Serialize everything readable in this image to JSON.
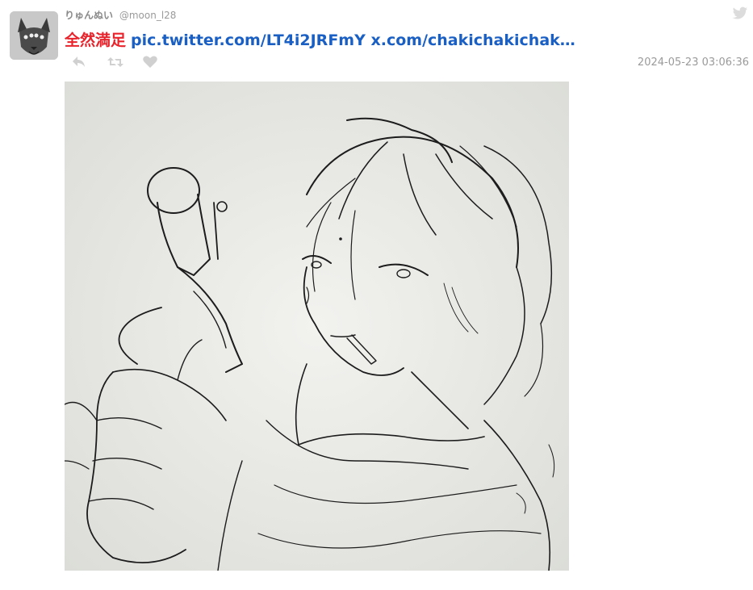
{
  "user": {
    "display_name": "りゅんぬい",
    "screen_name": "@moon_l28",
    "avatar_icon": "wolf-avatar-icon"
  },
  "tweet": {
    "text_jp": "全然満足",
    "link_1": "pic.twitter.com/LT4i2JRFmY",
    "link_2": "x.com/chakichakichak…",
    "timestamp": "2024-05-23 03:06:36"
  },
  "actions": {
    "reply_icon": "reply-icon",
    "retweet_icon": "retweet-icon",
    "like_icon": "heart-icon"
  },
  "colors": {
    "jp_text": "#e8232b",
    "link": "#1a5fc4",
    "muted": "#9a9a9a",
    "action_icon": "#cfcfcf"
  }
}
